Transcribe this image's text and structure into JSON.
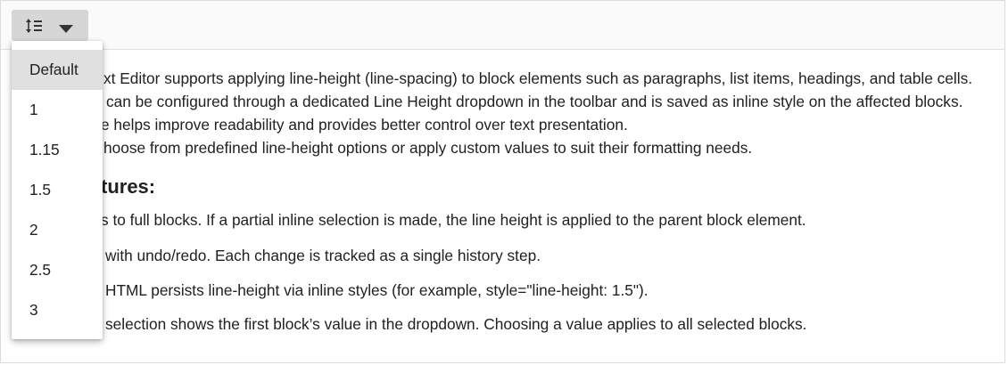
{
  "toolbar": {
    "line_height_icon": "line-height-icon",
    "caret_icon": "chevron-down-icon"
  },
  "dropdown": {
    "selected": "Default",
    "options": [
      "Default",
      "1",
      "1.15",
      "1.5",
      "2",
      "2.5",
      "3"
    ]
  },
  "content": {
    "lines": [
      "xt Editor supports applying line-height (line-spacing) to block elements such as paragraphs, list items, headings, and table cells.",
      "can be configured through a dedicated Line Height dropdown in the toolbar and is saved as inline style on the affected blocks.",
      "e helps improve readability and provides better control over text presentation.",
      "hoose from predefined line-height options or apply custom values to suit their formatting needs."
    ],
    "heading": "tures:",
    "bullets": [
      "s to full blocks. If a partial inline selection is made, the line height is applied to the parent block element.",
      "with undo/redo. Each change is tracked as a single history step.",
      "HTML persists line-height via inline styles (for example, style=\"line-height: 1.5\").",
      "selection shows the first block’s value in the dropdown. Choosing a value applies to all selected blocks."
    ]
  }
}
